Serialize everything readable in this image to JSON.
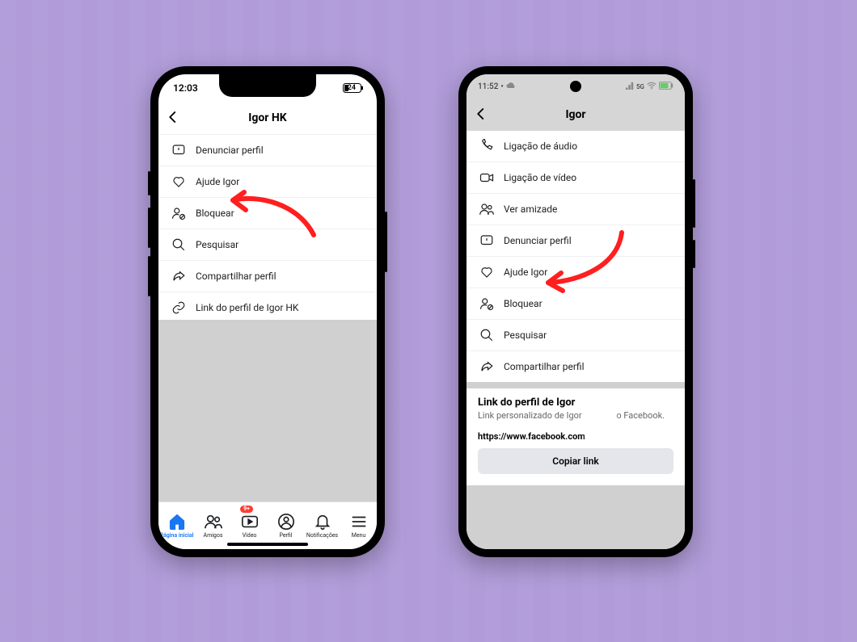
{
  "ios": {
    "status": {
      "time": "12:03",
      "battery": "24"
    },
    "header": {
      "title": "Igor HK"
    },
    "menu": [
      {
        "id": "report",
        "label": "Denunciar perfil"
      },
      {
        "id": "help",
        "label": "Ajude Igor"
      },
      {
        "id": "block",
        "label": "Bloquear"
      },
      {
        "id": "search",
        "label": "Pesquisar"
      },
      {
        "id": "share",
        "label": "Compartilhar perfil"
      },
      {
        "id": "link",
        "label": "Link do perfil de Igor HK"
      }
    ],
    "tabs": {
      "home": "Página inicial",
      "friends": "Amigos",
      "video": "Vídeo",
      "profile": "Perfil",
      "notif": "Notificações",
      "menu": "Menu",
      "badge": "9+"
    }
  },
  "and": {
    "status": {
      "time": "11:52",
      "net": "5G"
    },
    "header": {
      "title": "Igor"
    },
    "menu": [
      {
        "id": "audio",
        "label": "Ligação de áudio"
      },
      {
        "id": "video",
        "label": "Ligação de vídeo"
      },
      {
        "id": "friend",
        "label": "Ver amizade"
      },
      {
        "id": "report",
        "label": "Denunciar perfil"
      },
      {
        "id": "help",
        "label": "Ajude Igor"
      },
      {
        "id": "block",
        "label": "Bloquear"
      },
      {
        "id": "search",
        "label": "Pesquisar"
      },
      {
        "id": "share",
        "label": "Compartilhar perfil"
      }
    ],
    "link_section": {
      "title": "Link do perfil de Igor",
      "subtitle_prefix": "Link personalizado de Igor",
      "subtitle_suffix": "o Facebook.",
      "url": "https://www.facebook.com",
      "copy": "Copiar link"
    }
  }
}
